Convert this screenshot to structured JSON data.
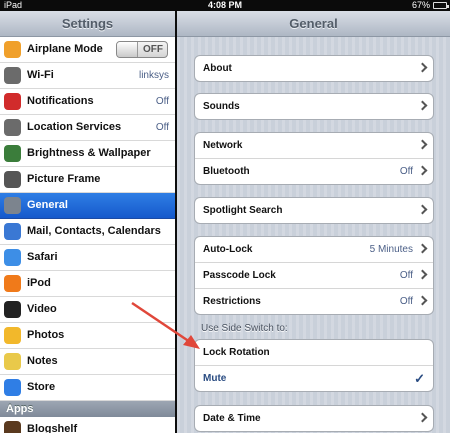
{
  "status_bar": {
    "device": "iPad",
    "time": "4:08 PM",
    "battery": "67%",
    "battery_level": 0.67
  },
  "master": {
    "title": "Settings",
    "items": [
      {
        "label": "Airplane Mode",
        "icon": "airplane-icon",
        "toggle": "OFF",
        "color": "#f0a02b"
      },
      {
        "label": "Wi-Fi",
        "icon": "wifi-icon",
        "value": "linksys",
        "color": "#6b6b6b"
      },
      {
        "label": "Notifications",
        "icon": "notifications-icon",
        "value": "Off",
        "color": "#d12b2b"
      },
      {
        "label": "Location Services",
        "icon": "location-icon",
        "value": "Off",
        "color": "#6b6b6b"
      },
      {
        "label": "Brightness & Wallpaper",
        "icon": "brightness-icon",
        "color": "#3b7d3b"
      },
      {
        "label": "Picture Frame",
        "icon": "picture-frame-icon",
        "color": "#555555"
      },
      {
        "label": "General",
        "icon": "gear-icon",
        "color": "#7c848e",
        "selected": true
      },
      {
        "label": "Mail, Contacts, Calendars",
        "icon": "mail-icon",
        "color": "#3a78d4"
      },
      {
        "label": "Safari",
        "icon": "safari-icon",
        "color": "#3d8ee6"
      },
      {
        "label": "iPod",
        "icon": "ipod-icon",
        "color": "#f07a1a"
      },
      {
        "label": "Video",
        "icon": "video-icon",
        "color": "#222222"
      },
      {
        "label": "Photos",
        "icon": "photos-icon",
        "color": "#f2b82b"
      },
      {
        "label": "Notes",
        "icon": "notes-icon",
        "color": "#e9c94a"
      },
      {
        "label": "Store",
        "icon": "store-icon",
        "color": "#2f7ee5"
      }
    ],
    "apps_header": "Apps",
    "apps": [
      {
        "label": "Blogshelf",
        "icon": "blogshelf-icon",
        "color": "#5a3a1f"
      }
    ]
  },
  "detail": {
    "title": "General",
    "about": "About",
    "sounds": "Sounds",
    "network": "Network",
    "bluetooth": "Bluetooth",
    "bluetooth_value": "Off",
    "spotlight": "Spotlight Search",
    "auto_lock": "Auto-Lock",
    "auto_lock_value": "5 Minutes",
    "passcode": "Passcode Lock",
    "passcode_value": "Off",
    "restrictions": "Restrictions",
    "restrictions_value": "Off",
    "side_switch_label": "Use Side Switch to:",
    "lock_rotation": "Lock Rotation",
    "mute": "Mute",
    "check": "✓",
    "date_time": "Date & Time"
  },
  "colors": {
    "accent": "#1f6ad6",
    "annotation": "#e0473a"
  }
}
